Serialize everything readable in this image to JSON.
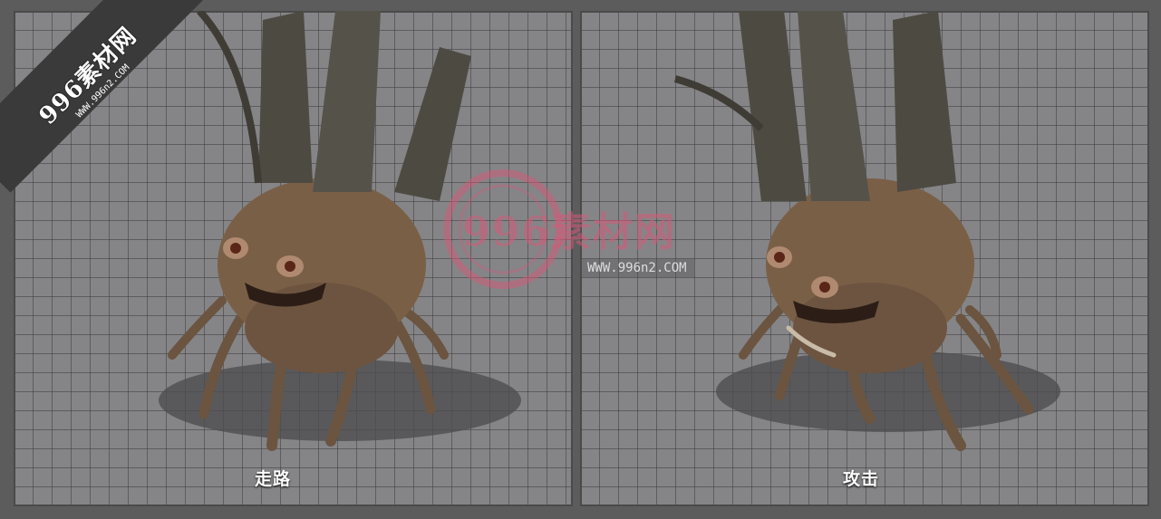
{
  "logo": {
    "name": "996素材网",
    "url": "WWW.996n2.COM"
  },
  "watermark": {
    "name": "996素材网",
    "url": "WWW.996n2.COM"
  },
  "panels": [
    {
      "caption": "走路"
    },
    {
      "caption": "攻击"
    }
  ]
}
